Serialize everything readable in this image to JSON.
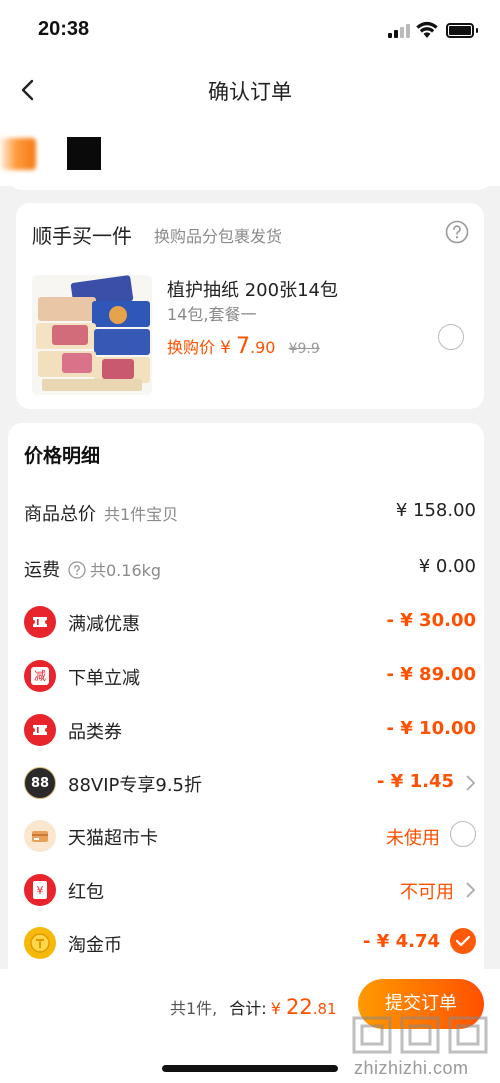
{
  "status": {
    "time": "20:38"
  },
  "nav": {
    "title": "确认订单"
  },
  "addon": {
    "title": "顺手买一件",
    "subtitle": "换购品分包裹发货",
    "product": {
      "name": "植护抽纸 200张14包",
      "variant": "14包,套餐一",
      "price_label": "换购价",
      "currency": "¥",
      "price_int": "7",
      "price_dec": ".90",
      "original_price": "¥9.9"
    }
  },
  "price_detail": {
    "title": "价格明细",
    "rows": [
      {
        "label": "商品总价",
        "note": "共1件宝贝",
        "value": "¥ 158.00"
      },
      {
        "label": "运费",
        "note": "共0.16kg",
        "value": "¥ 0.00"
      },
      {
        "label": "满减优惠",
        "value": "- ¥ 30.00"
      },
      {
        "label": "下单立减",
        "value": "- ¥ 89.00",
        "icon_text": "减"
      },
      {
        "label": "品类券",
        "value": "- ¥ 10.00"
      },
      {
        "label": "88VIP专享9.5折",
        "value": "- ¥ 1.45",
        "icon_text": "88"
      },
      {
        "label": "天猫超市卡",
        "value": "未使用"
      },
      {
        "label": "红包",
        "value": "不可用",
        "icon_text": "¥"
      },
      {
        "label": "淘金币",
        "value": "- ¥ 4.74"
      }
    ]
  },
  "bottom": {
    "count": "共1件,",
    "total_label": "合计:",
    "currency": "¥",
    "total_int": "22",
    "total_dec": ".81",
    "submit": "提交订单"
  },
  "watermark": {
    "text": "zhizhizhi.com"
  },
  "colors": {
    "accent": "#ff5000",
    "badge_red": "#e8242d",
    "coin_gold": "#f5b80b"
  }
}
